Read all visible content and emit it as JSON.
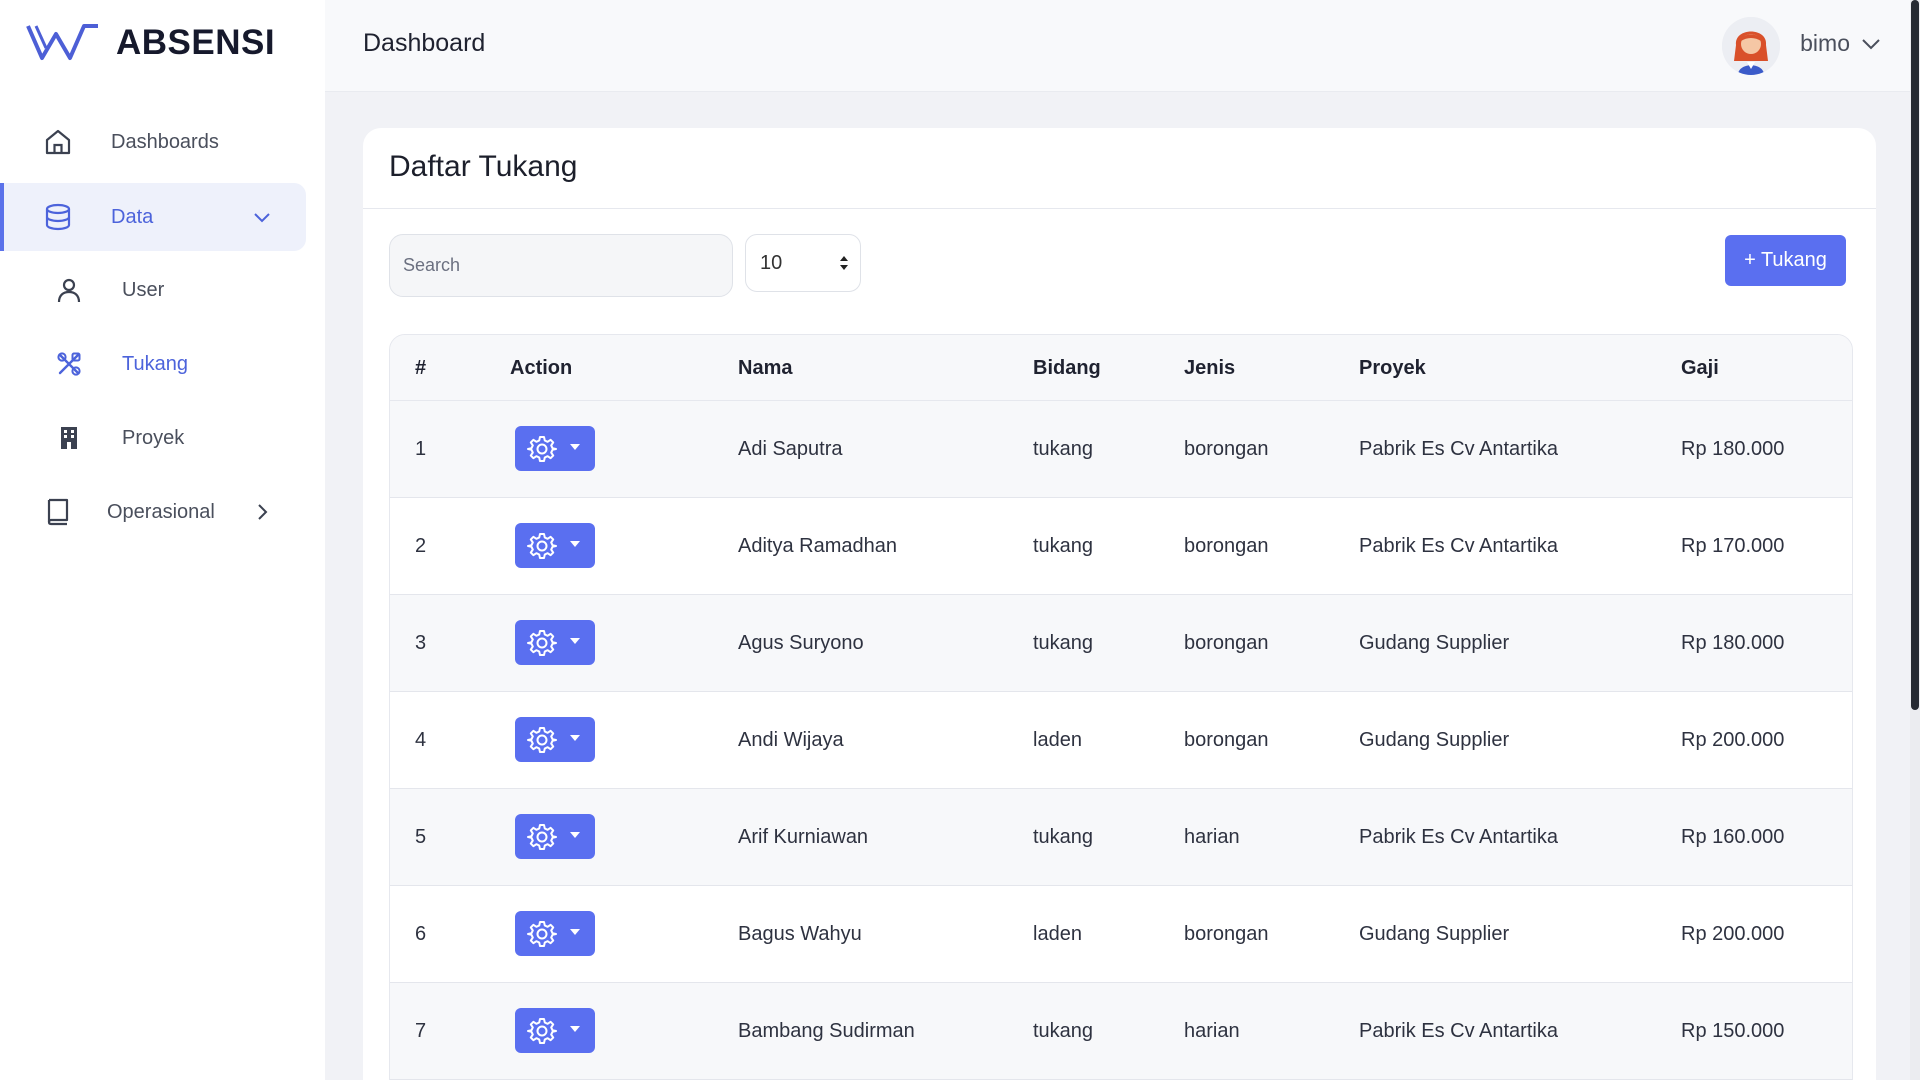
{
  "app": {
    "name": "ABSENSI"
  },
  "sidebar": {
    "items": [
      {
        "label": "Dashboards",
        "icon": "home-icon"
      },
      {
        "label": "Data",
        "icon": "database-icon"
      },
      {
        "label": "User",
        "icon": "user-icon"
      },
      {
        "label": "Tukang",
        "icon": "tools-icon"
      },
      {
        "label": "Proyek",
        "icon": "building-icon"
      },
      {
        "label": "Operasional",
        "icon": "book-icon"
      }
    ]
  },
  "header": {
    "title": "Dashboard",
    "username": "bimo"
  },
  "card": {
    "title": "Daftar Tukang",
    "search_placeholder": "Search",
    "per_page": "10",
    "add_label": "+ Tukang"
  },
  "table": {
    "headers": [
      "#",
      "Action",
      "Nama",
      "Bidang",
      "Jenis",
      "Proyek",
      "Gaji"
    ],
    "rows": [
      {
        "no": "1",
        "nama": "Adi Saputra",
        "bidang": "tukang",
        "jenis": "borongan",
        "proyek": "Pabrik Es Cv Antartika",
        "gaji": "Rp 180.000"
      },
      {
        "no": "2",
        "nama": "Aditya Ramadhan",
        "bidang": "tukang",
        "jenis": "borongan",
        "proyek": "Pabrik Es Cv Antartika",
        "gaji": "Rp 170.000"
      },
      {
        "no": "3",
        "nama": "Agus Suryono",
        "bidang": "tukang",
        "jenis": "borongan",
        "proyek": "Gudang Supplier",
        "gaji": "Rp 180.000"
      },
      {
        "no": "4",
        "nama": "Andi Wijaya",
        "bidang": "laden",
        "jenis": "borongan",
        "proyek": "Gudang Supplier",
        "gaji": "Rp 200.000"
      },
      {
        "no": "5",
        "nama": "Arif Kurniawan",
        "bidang": "tukang",
        "jenis": "harian",
        "proyek": "Pabrik Es Cv Antartika",
        "gaji": "Rp 160.000"
      },
      {
        "no": "6",
        "nama": "Bagus Wahyu",
        "bidang": "laden",
        "jenis": "borongan",
        "proyek": "Gudang Supplier",
        "gaji": "Rp 200.000"
      },
      {
        "no": "7",
        "nama": "Bambang Sudirman",
        "bidang": "tukang",
        "jenis": "harian",
        "proyek": "Pabrik Es Cv Antartika",
        "gaji": "Rp 150.000"
      }
    ]
  },
  "colors": {
    "accent": "#5a6ff0",
    "active_text": "#4c63db",
    "brand": "#4d5fd6"
  }
}
